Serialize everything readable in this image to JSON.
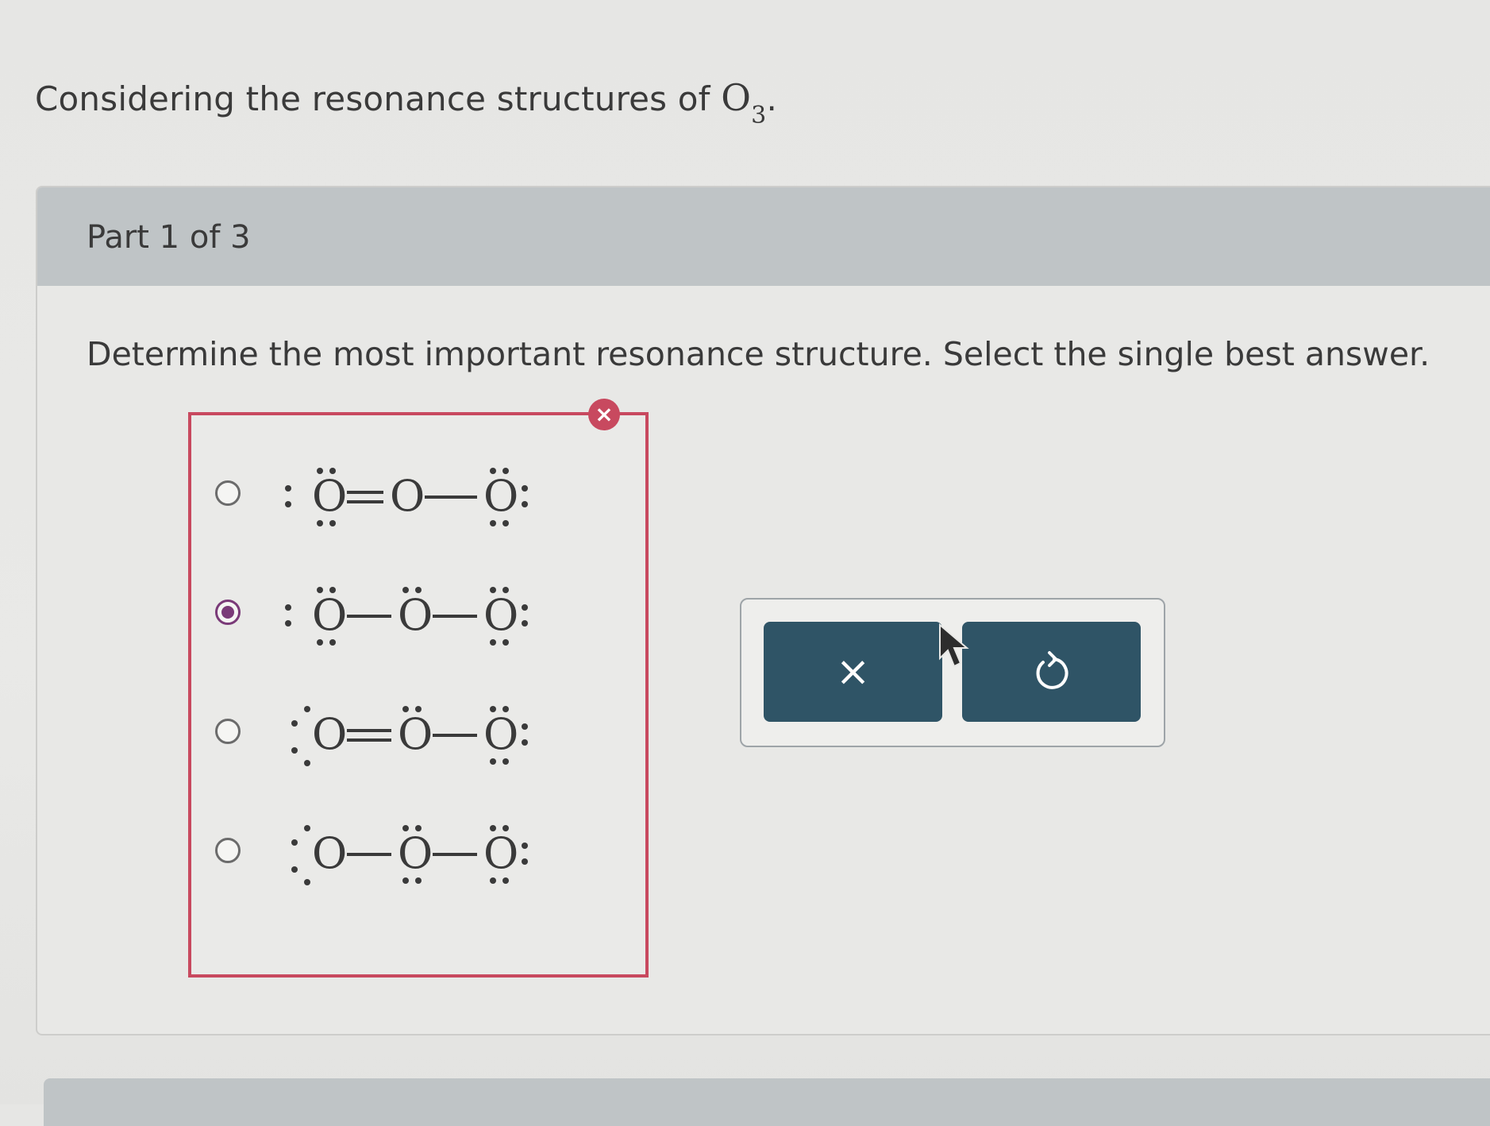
{
  "question": {
    "prefix": "Considering the resonance structures of ",
    "formula": "O",
    "subscript": "3",
    "suffix": "."
  },
  "part": {
    "label": "Part 1 of 3"
  },
  "instruction": "Determine the most important resonance structure. Select the single best answer.",
  "options": [
    {
      "formula": ":Ö=O−Ö:",
      "selected": false
    },
    {
      "formula": ":Ö−Ö−Ö:",
      "selected": true
    },
    {
      "formula": "Ö=Ö−Ö:",
      "selected": false
    },
    {
      "formula": "Ö−Ö−Ö:",
      "selected": false
    }
  ],
  "feedback": {
    "status": "incorrect",
    "badge_symbol": "×"
  },
  "tools": {
    "clear_symbol": "×"
  },
  "colors": {
    "error": "#c8495f",
    "button": "#2f5466",
    "radio_selected": "#7a3a78",
    "header_band": "#bfc4c6"
  }
}
